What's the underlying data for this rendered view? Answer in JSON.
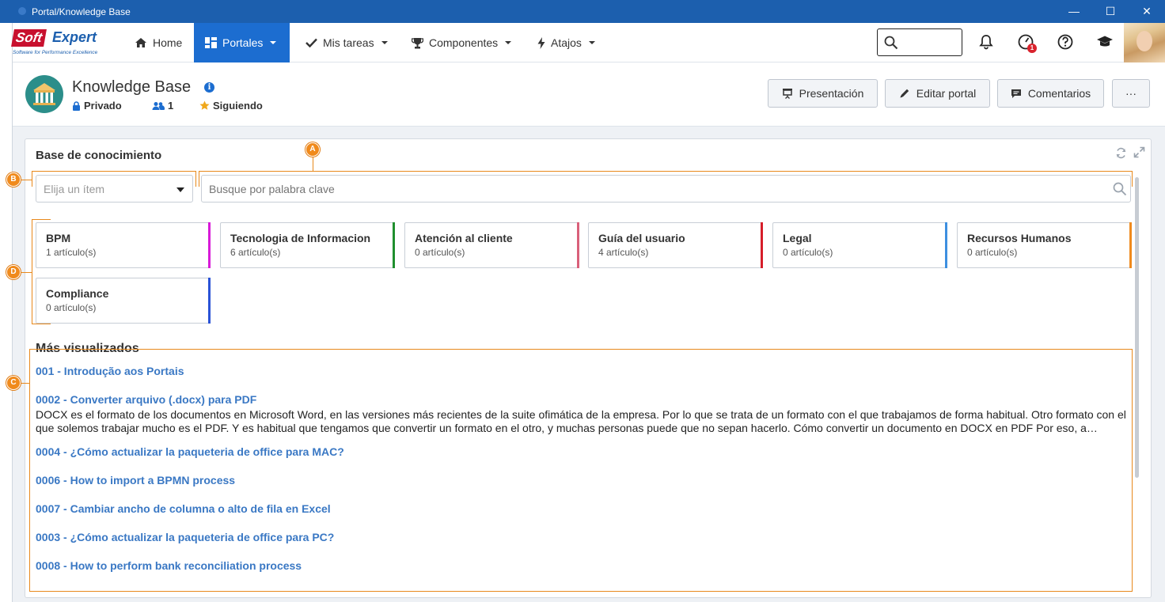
{
  "window": {
    "title": "Portal/Knowledge Base",
    "controls": {
      "minimize": "—",
      "maximize": "☐",
      "close": "✕"
    }
  },
  "logo": {
    "brand_left": "Soft",
    "brand_right": "Expert",
    "tagline": "Software for Performance Excellence"
  },
  "nav": {
    "items": [
      {
        "label": "Home",
        "icon": "home-icon"
      },
      {
        "label": "Portales",
        "icon": "dashboard-icon",
        "active": true
      },
      {
        "label": "Mis tareas",
        "icon": "check-icon"
      },
      {
        "label": "Componentes",
        "icon": "trophy-icon"
      },
      {
        "label": "Atajos",
        "icon": "bolt-icon"
      }
    ],
    "search_placeholder": "",
    "notification_badge": "1",
    "accent_color": "#1c6dd0"
  },
  "portal": {
    "title": "Knowledge Base",
    "privacy": "Privado",
    "members": "1",
    "following": "Siguiendo",
    "buttons": {
      "presentation": "Presentación",
      "edit": "Editar portal",
      "comments": "Comentarios",
      "more": "···"
    }
  },
  "widget": {
    "title": "Base de conocimiento",
    "select_placeholder": "Elija un ítem",
    "search_placeholder": "Busque por palabra clave",
    "categories": [
      {
        "name": "BPM",
        "count": "1 artículo(s)",
        "color": "#d81bd8"
      },
      {
        "name": "Tecnologia de Informacion",
        "count": "6 artículo(s)",
        "color": "#1f8f2e"
      },
      {
        "name": "Atención al cliente",
        "count": "0 artículo(s)",
        "color": "#d9607a"
      },
      {
        "name": "Guía del usuario",
        "count": "4 artículo(s)",
        "color": "#d61e2a"
      },
      {
        "name": "Legal",
        "count": "0 artículo(s)",
        "color": "#3d8fe0"
      },
      {
        "name": "Recursos Humanos",
        "count": "0 artículo(s)",
        "color": "#ef8a1e"
      },
      {
        "name": "Compliance",
        "count": "0 artículo(s)",
        "color": "#2a52d6"
      }
    ],
    "most_viewed_title": "Más visualizados",
    "articles": [
      {
        "title": "001 - Introdução aos Portais"
      },
      {
        "title": "0002 - Converter arquivo (.docx) para PDF",
        "desc": "DOCX es el formato de los documentos en Microsoft Word, en las versiones más recientes de la suite ofimática de la empresa. Por lo que se trata de un formato con el que trabajamos de forma habitual. Otro formato con el que solemos trabajar mucho es el PDF. Y es habitual que tengamos que convertir un formato en el otro, y muchas personas puede que no sepan hacerlo. Cómo convertir un documento en DOCX en PDF Por eso, a…"
      },
      {
        "title": "0004 - ¿Cómo actualizar la paqueteria de office para MAC?"
      },
      {
        "title": "0006 - How to import a BPMN process"
      },
      {
        "title": "0007 - Cambiar ancho de columna o alto de fila en Excel"
      },
      {
        "title": "0003 - ¿Cómo actualizar la paqueteria de office para PC?"
      },
      {
        "title": "0008 - How to perform bank reconciliation process"
      }
    ]
  },
  "annotations": {
    "A": "A",
    "B": "B",
    "C": "C",
    "D": "D",
    "color": "#f08a1c"
  }
}
